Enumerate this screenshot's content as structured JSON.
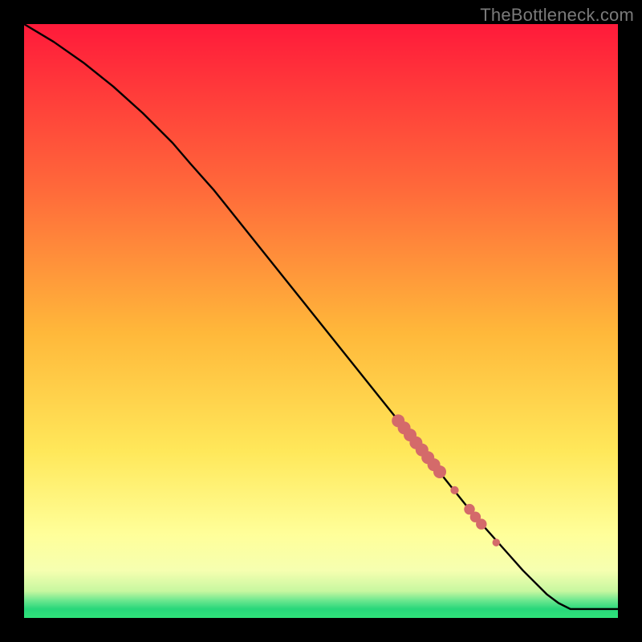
{
  "watermark": "TheBottleneck.com",
  "colors": {
    "background": "#000000",
    "line": "#000000",
    "marker": "#d46a6a",
    "gradient_top": "#ff1a3a",
    "gradient_mid1": "#ff8a2a",
    "gradient_mid2": "#ffe770",
    "gradient_mid3": "#ffffa8",
    "gradient_green": "#2fe37a"
  },
  "chart_data": {
    "type": "line",
    "title": "",
    "xlabel": "",
    "ylabel": "",
    "xlim": [
      0,
      100
    ],
    "ylim": [
      0,
      100
    ],
    "series": [
      {
        "name": "curve",
        "x": [
          0,
          5,
          10,
          15,
          20,
          25,
          28,
          32,
          36,
          40,
          44,
          48,
          52,
          56,
          60,
          64,
          68,
          72,
          76,
          80,
          84,
          88,
          90,
          92,
          95,
          100
        ],
        "y": [
          100,
          97,
          93.5,
          89.5,
          85,
          80,
          76.5,
          72,
          67,
          62,
          57,
          52,
          47,
          42,
          37,
          32,
          27,
          22,
          17,
          12.5,
          8,
          4,
          2.5,
          1.5,
          1.5,
          1.5
        ]
      }
    ],
    "markers": {
      "name": "highlight-cluster",
      "points": [
        {
          "x": 63,
          "y": 33.2,
          "r": 5
        },
        {
          "x": 64,
          "y": 32.0,
          "r": 5
        },
        {
          "x": 65,
          "y": 30.8,
          "r": 5
        },
        {
          "x": 66,
          "y": 29.5,
          "r": 5
        },
        {
          "x": 67,
          "y": 28.3,
          "r": 5
        },
        {
          "x": 68,
          "y": 27.0,
          "r": 5
        },
        {
          "x": 69,
          "y": 25.8,
          "r": 5
        },
        {
          "x": 70,
          "y": 24.6,
          "r": 5
        },
        {
          "x": 72.5,
          "y": 21.5,
          "r": 3.2
        },
        {
          "x": 75.0,
          "y": 18.3,
          "r": 4.2
        },
        {
          "x": 76.0,
          "y": 17.0,
          "r": 4.2
        },
        {
          "x": 77.0,
          "y": 15.8,
          "r": 4.2
        },
        {
          "x": 79.5,
          "y": 12.7,
          "r": 3.0
        }
      ]
    }
  }
}
